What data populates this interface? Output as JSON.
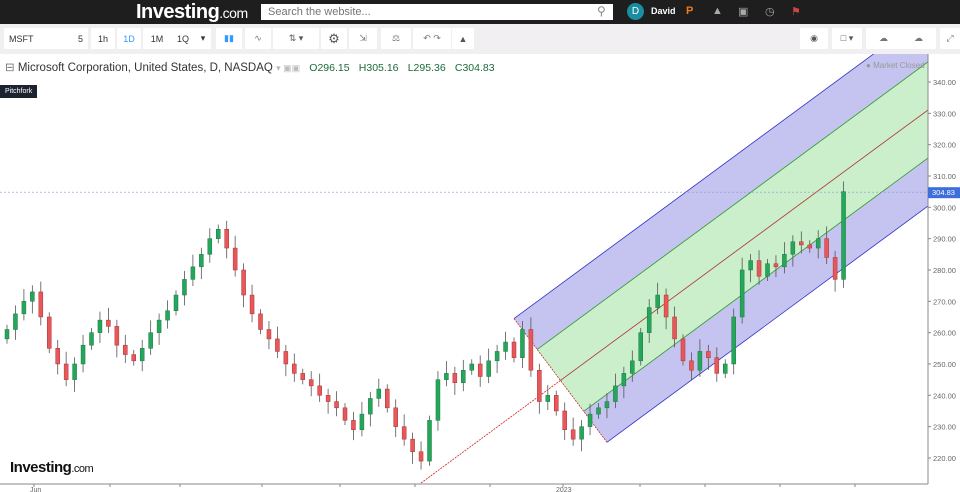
{
  "header": {
    "logo": "Investing",
    "logo_suffix": ".com",
    "search_placeholder": "Search the website...",
    "user_initial": "D",
    "user_name": "David"
  },
  "toolbar": {
    "symbol": "MSFT",
    "intervals": [
      "5",
      "1h",
      "1D",
      "1M",
      "1Q"
    ],
    "active_interval": "1D"
  },
  "legend": {
    "title": "Microsoft Corporation, United States, D, NASDAQ",
    "open": "O296.15",
    "high": "H305.16",
    "low": "L295.36",
    "close": "C304.83",
    "status": "Market Closed",
    "drawing_label": "Pitchfork"
  },
  "watermark": {
    "text": "Investing",
    "suffix": ".com"
  },
  "colors": {
    "up": "#26a65b",
    "down": "#e8585a",
    "pitch_outer": "#c5c3ef",
    "pitch_inner": "#cbefcb",
    "price_tag": "#3c6fdc"
  },
  "chart_data": {
    "type": "candlestick",
    "symbol": "MSFT",
    "last_price": "304.83",
    "ylim": [
      212,
      346
    ],
    "yticks": [
      "340.00",
      "330.00",
      "320.00",
      "310.00",
      "300.00",
      "290.00",
      "280.00",
      "270.00",
      "260.00",
      "250.00",
      "240.00",
      "230.00",
      "220.00"
    ],
    "ytick_values": [
      340,
      330,
      320,
      310,
      300,
      290,
      280,
      270,
      260,
      250,
      240,
      230,
      220
    ],
    "xlabels": [
      {
        "label": "Jun",
        "index": 3
      },
      {
        "label": "2023",
        "index": 66
      }
    ],
    "closes": [
      261,
      266,
      270,
      273,
      265,
      255,
      250,
      245,
      250,
      256,
      260,
      264,
      262,
      256,
      253,
      251,
      255,
      260,
      264,
      267,
      272,
      277,
      281,
      285,
      290,
      293,
      287,
      280,
      272,
      266,
      261,
      258,
      254,
      250,
      247,
      245,
      243,
      240,
      238,
      236,
      232,
      229,
      234,
      239,
      242,
      236,
      230,
      226,
      222,
      219,
      232,
      245,
      247,
      244,
      248,
      250,
      246,
      251,
      254,
      257,
      252,
      261,
      248,
      238,
      240,
      235,
      229,
      226,
      230,
      234,
      236,
      238,
      243,
      247,
      251,
      260,
      268,
      272,
      265,
      258,
      251,
      248,
      254,
      252,
      247,
      250,
      265,
      280,
      283,
      278,
      282,
      281,
      285,
      289,
      288,
      287,
      290,
      284,
      277,
      305
    ],
    "first_open": 258,
    "pitchfork": {
      "pivot_index": 49,
      "pivot_price": 212,
      "high_index": 60,
      "high_price": 264.5,
      "low_index": 71,
      "low_price": 225
    }
  }
}
